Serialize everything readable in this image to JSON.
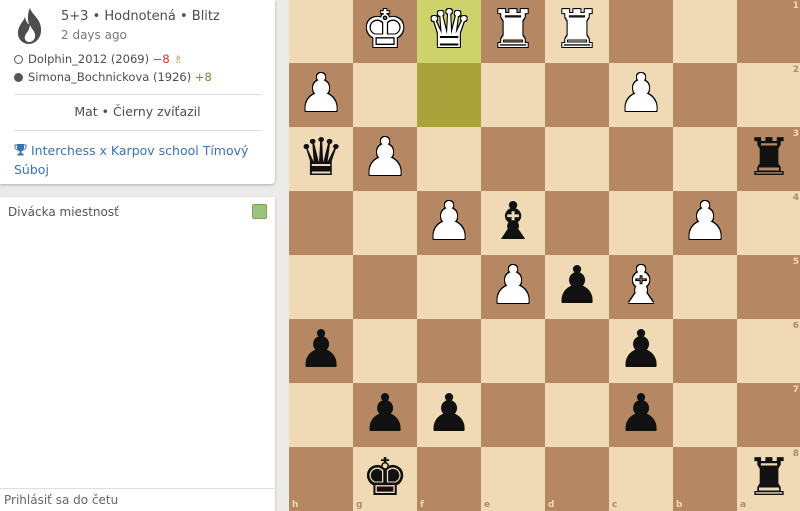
{
  "game": {
    "format": "5+3 • Hodnotená • Blitz",
    "date": "2 days ago",
    "result": "Mat • Čierny zvíťazil",
    "tournament": "Interchess x Karpov school Tímový Súboj"
  },
  "players": [
    {
      "side": "white",
      "name": "Dolphin_2012 (2069)",
      "diff": "−8",
      "diff_color": "negative",
      "badge": "berserk-icon"
    },
    {
      "side": "black",
      "name": "Simona_Bochnickova (1926)",
      "diff": "+8",
      "diff_color": "positive"
    }
  ],
  "chat": {
    "title": "Divácka miestnosť",
    "placeholder": "Prihlásiť sa do četu"
  },
  "board": {
    "orientation": "black",
    "light_color": "#f0d9b5",
    "dark_color": "#b58863",
    "last_move": [
      "f1",
      "f2"
    ],
    "ranks": [
      "1",
      "2",
      "3",
      "4",
      "5",
      "6",
      "7",
      "8"
    ],
    "files": [
      "h",
      "g",
      "f",
      "e",
      "d",
      "c",
      "b",
      "a"
    ],
    "pieces": [
      {
        "square": "g1",
        "piece": "K",
        "color": "white"
      },
      {
        "square": "f1",
        "piece": "Q",
        "color": "white"
      },
      {
        "square": "e1",
        "piece": "R",
        "color": "white"
      },
      {
        "square": "d1",
        "piece": "R",
        "color": "white"
      },
      {
        "square": "h2",
        "piece": "P",
        "color": "white"
      },
      {
        "square": "c2",
        "piece": "P",
        "color": "white"
      },
      {
        "square": "h3",
        "piece": "Q",
        "color": "black"
      },
      {
        "square": "g3",
        "piece": "P",
        "color": "white"
      },
      {
        "square": "a3",
        "piece": "R",
        "color": "black"
      },
      {
        "square": "f4",
        "piece": "P",
        "color": "white"
      },
      {
        "square": "e4",
        "piece": "B",
        "color": "black"
      },
      {
        "square": "b4",
        "piece": "P",
        "color": "white"
      },
      {
        "square": "e5",
        "piece": "P",
        "color": "white"
      },
      {
        "square": "d5",
        "piece": "P",
        "color": "black"
      },
      {
        "square": "c5",
        "piece": "B",
        "color": "white"
      },
      {
        "square": "h6",
        "piece": "P",
        "color": "black"
      },
      {
        "square": "c6",
        "piece": "P",
        "color": "black"
      },
      {
        "square": "g7",
        "piece": "P",
        "color": "black"
      },
      {
        "square": "f7",
        "piece": "P",
        "color": "black"
      },
      {
        "square": "c7",
        "piece": "P",
        "color": "black"
      },
      {
        "square": "g8",
        "piece": "K",
        "color": "black"
      },
      {
        "square": "a8",
        "piece": "R",
        "color": "black"
      }
    ]
  }
}
